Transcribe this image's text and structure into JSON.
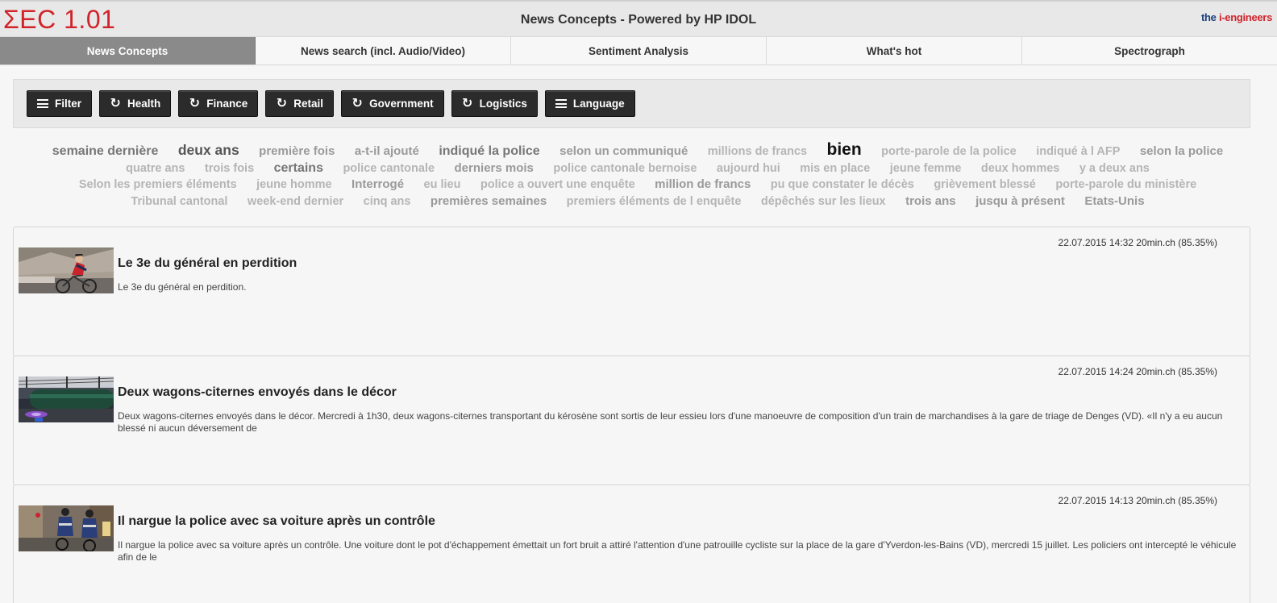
{
  "header": {
    "logo_text": "ΣEC 1.01",
    "title": "News Concepts - Powered by HP IDOL",
    "right_logo": {
      "part1": "the ",
      "part2": "i",
      "part3": "-engineers"
    }
  },
  "tabs": [
    {
      "label": "News Concepts",
      "active": true
    },
    {
      "label": "News search (incl. Audio/Video)"
    },
    {
      "label": "Sentiment Analysis"
    },
    {
      "label": "What's hot"
    },
    {
      "label": "Spectrograph"
    }
  ],
  "filters": [
    {
      "label": "Filter",
      "icon": "menu-icon"
    },
    {
      "label": "Health",
      "icon": "redo-icon"
    },
    {
      "label": "Finance",
      "icon": "redo-icon"
    },
    {
      "label": "Retail",
      "icon": "redo-icon"
    },
    {
      "label": "Government",
      "icon": "redo-icon"
    },
    {
      "label": "Logistics",
      "icon": "redo-icon"
    },
    {
      "label": "Language",
      "icon": "menu-icon"
    }
  ],
  "concept_cloud": [
    {
      "text": "semaine dernière",
      "weight": 3
    },
    {
      "text": "deux ans",
      "weight": 4
    },
    {
      "text": "première fois",
      "weight": 2
    },
    {
      "text": "a-t-il ajouté",
      "weight": 2
    },
    {
      "text": "indiqué la police",
      "weight": 3
    },
    {
      "text": "selon un communiqué",
      "weight": 2
    },
    {
      "text": "millions de francs",
      "weight": 1
    },
    {
      "text": "bien",
      "weight": 5
    },
    {
      "text": "porte-parole de la police",
      "weight": 1
    },
    {
      "text": "indiqué à l AFP",
      "weight": 1
    },
    {
      "text": "selon la police",
      "weight": 2
    },
    {
      "text": "quatre ans",
      "weight": 1
    },
    {
      "text": "trois fois",
      "weight": 1
    },
    {
      "text": "certains",
      "weight": 3
    },
    {
      "text": "police cantonale",
      "weight": 1
    },
    {
      "text": "derniers mois",
      "weight": 2
    },
    {
      "text": "police cantonale bernoise",
      "weight": 1
    },
    {
      "text": "aujourd hui",
      "weight": 1
    },
    {
      "text": "mis en place",
      "weight": 1
    },
    {
      "text": "jeune femme",
      "weight": 1
    },
    {
      "text": "deux hommes",
      "weight": 1
    },
    {
      "text": "y a deux ans",
      "weight": 1
    },
    {
      "text": "Selon les premiers éléments",
      "weight": 1
    },
    {
      "text": "jeune homme",
      "weight": 1
    },
    {
      "text": "Interrogé",
      "weight": 2
    },
    {
      "text": "eu lieu",
      "weight": 1
    },
    {
      "text": "police a ouvert une enquête",
      "weight": 1
    },
    {
      "text": "million de francs",
      "weight": 2
    },
    {
      "text": "pu que constater le décès",
      "weight": 1
    },
    {
      "text": "grièvement blessé",
      "weight": 1
    },
    {
      "text": "porte-parole du ministère",
      "weight": 1
    },
    {
      "text": "Tribunal cantonal",
      "weight": 1
    },
    {
      "text": "week-end dernier",
      "weight": 1
    },
    {
      "text": "cinq ans",
      "weight": 1
    },
    {
      "text": "premières semaines",
      "weight": 2
    },
    {
      "text": "premiers éléments de l enquête",
      "weight": 1
    },
    {
      "text": "dépêchés sur les lieux",
      "weight": 1
    },
    {
      "text": "trois ans",
      "weight": 2
    },
    {
      "text": "jusqu à présent",
      "weight": 2
    },
    {
      "text": "Etats-Unis",
      "weight": 2
    }
  ],
  "articles": [
    {
      "meta": "22.07.2015 14:32 20min.ch (85.35%)",
      "title": "Le 3e du général en perdition",
      "description": "Le 3e du général en perdition.",
      "thumbnail": "cyclist-photo"
    },
    {
      "meta": "22.07.2015 14:24 20min.ch (85.35%)",
      "title": "Deux wagons-citernes envoyés dans le décor",
      "description": "Deux wagons-citernes envoyés dans le décor. Mercredi à 1h30, deux wagons-citernes transportant du kérosène sont sortis de leur essieu lors d'une manoeuvre de composition d'un train de marchandises à la gare de triage de Denges (VD). «Il n'y a eu aucun blessé ni aucun déversement de",
      "thumbnail": "tank-wagon-photo"
    },
    {
      "meta": "22.07.2015 14:13 20min.ch (85.35%)",
      "title": "Il nargue la police avec sa voiture après un contrôle",
      "description": "Il nargue la police avec sa voiture après un contrôle. Une voiture dont le pot d'échappement émettait un fort bruit a attiré l'attention d'une patrouille cycliste sur la place de la gare d'Yverdon-les-Bains (VD), mercredi 15 juillet. Les policiers ont intercepté le véhicule afin de le",
      "thumbnail": "police-cyclists-photo"
    }
  ]
}
